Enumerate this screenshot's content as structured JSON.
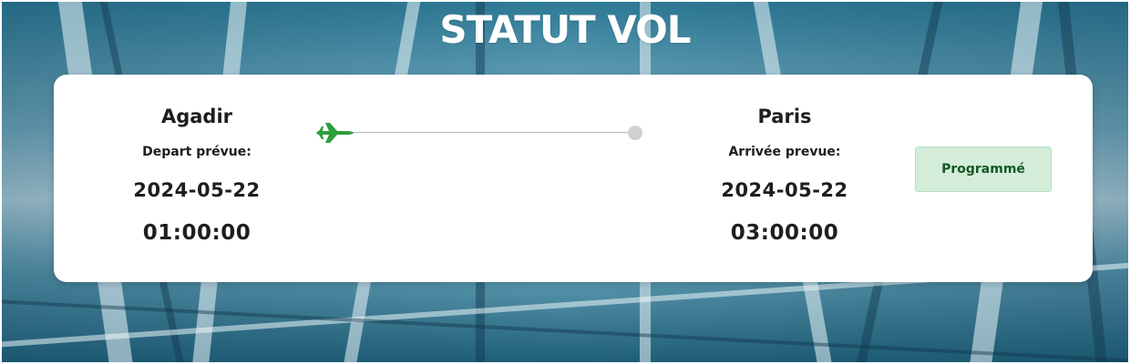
{
  "page": {
    "title": "STATUT VOL"
  },
  "flight": {
    "departure": {
      "city": "Agadir",
      "label": "Depart prévue:",
      "date": "2024-05-22",
      "time": "01:00:00"
    },
    "arrival": {
      "city": "Paris",
      "label": "Arrivée prevue:",
      "date": "2024-05-22",
      "time": "03:00:00"
    },
    "status": {
      "label": "Programmé",
      "color": "#155724",
      "background": "#d4edda"
    },
    "route": {
      "plane_icon": "airplane-icon",
      "plane_color": "#2e9e3c",
      "destination_marker_color": "#d0d0d0"
    }
  }
}
